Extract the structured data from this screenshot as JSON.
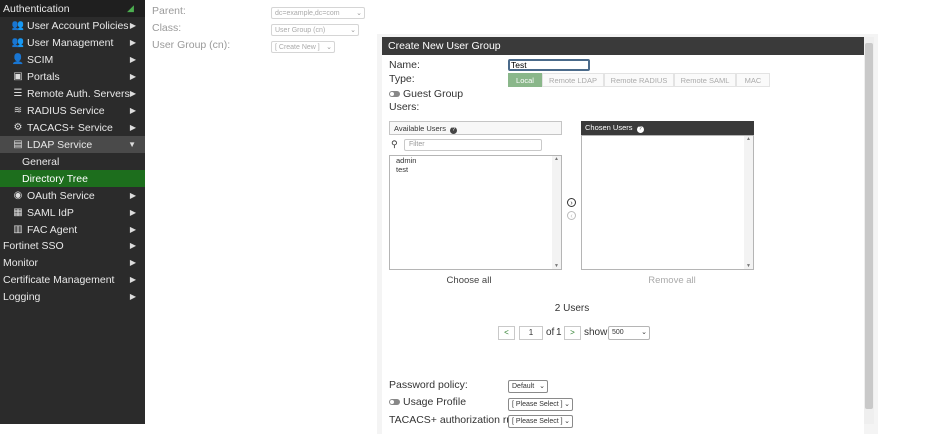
{
  "sidebar": {
    "header": "Authentication",
    "items": [
      {
        "label": "User Account Policies",
        "icon": "users-gear-icon",
        "glyph": "👥"
      },
      {
        "label": "User Management",
        "icon": "users-icon",
        "glyph": "👥"
      },
      {
        "label": "SCIM",
        "icon": "person-icon",
        "glyph": "👤"
      },
      {
        "label": "Portals",
        "icon": "portal-icon",
        "glyph": "▣"
      },
      {
        "label": "Remote Auth. Servers",
        "icon": "servers-icon",
        "glyph": "☰"
      },
      {
        "label": "RADIUS Service",
        "icon": "wifi-icon",
        "glyph": "≋"
      },
      {
        "label": "TACACS+ Service",
        "icon": "gear-icon",
        "glyph": "⚙"
      },
      {
        "label": "LDAP Service",
        "icon": "directory-icon",
        "glyph": "▤"
      },
      {
        "label": "General"
      },
      {
        "label": "Directory Tree"
      },
      {
        "label": "OAuth Service",
        "icon": "oauth-icon",
        "glyph": "◉"
      },
      {
        "label": "SAML IdP",
        "icon": "saml-icon",
        "glyph": "▦"
      },
      {
        "label": "FAC Agent",
        "icon": "agent-icon",
        "glyph": "▥"
      }
    ],
    "top_items": [
      "Fortinet SSO",
      "Monitor",
      "Certificate Management",
      "Logging"
    ]
  },
  "background_form": {
    "parent_label": "Parent:",
    "parent_value": "dc=example,dc=com",
    "class_label": "Class:",
    "class_value": "User Group (cn)",
    "user_group_label": "User Group (cn):",
    "user_group_value": "[ Create New ]"
  },
  "dialog": {
    "title": "Create New User Group",
    "name_label": "Name:",
    "name_value": "Test",
    "type_label": "Type:",
    "types": [
      "Local",
      "Remote LDAP",
      "Remote RADIUS",
      "Remote SAML",
      "MAC"
    ],
    "guest_group_label": "Guest Group",
    "users_label": "Users:",
    "available_users_label": "Available Users",
    "filter_placeholder": "Filter",
    "available_users": [
      "admin",
      "test"
    ],
    "chosen_users_label": "Chosen Users",
    "choose_all": "Choose all",
    "remove_all": "Remove all",
    "user_count": "2 Users",
    "pager": {
      "prev": "<",
      "page": "1",
      "of": "of",
      "total": "1",
      "next": ">",
      "show": "show",
      "page_size": "500"
    },
    "password_policy_label": "Password policy:",
    "password_policy_value": "Default",
    "usage_profile_label": "Usage Profile",
    "usage_profile_value": "[ Please Select ]",
    "tacacs_rule_label": "TACACS+ authorization rule:",
    "tacacs_rule_value": "[ Please Select ]"
  },
  "colors": {
    "sidebar_bg": "#2b2b2b",
    "active_sub": "#1d6e1d",
    "dialog_header": "#3a3a3a",
    "local_btn": "#8ab78a"
  }
}
